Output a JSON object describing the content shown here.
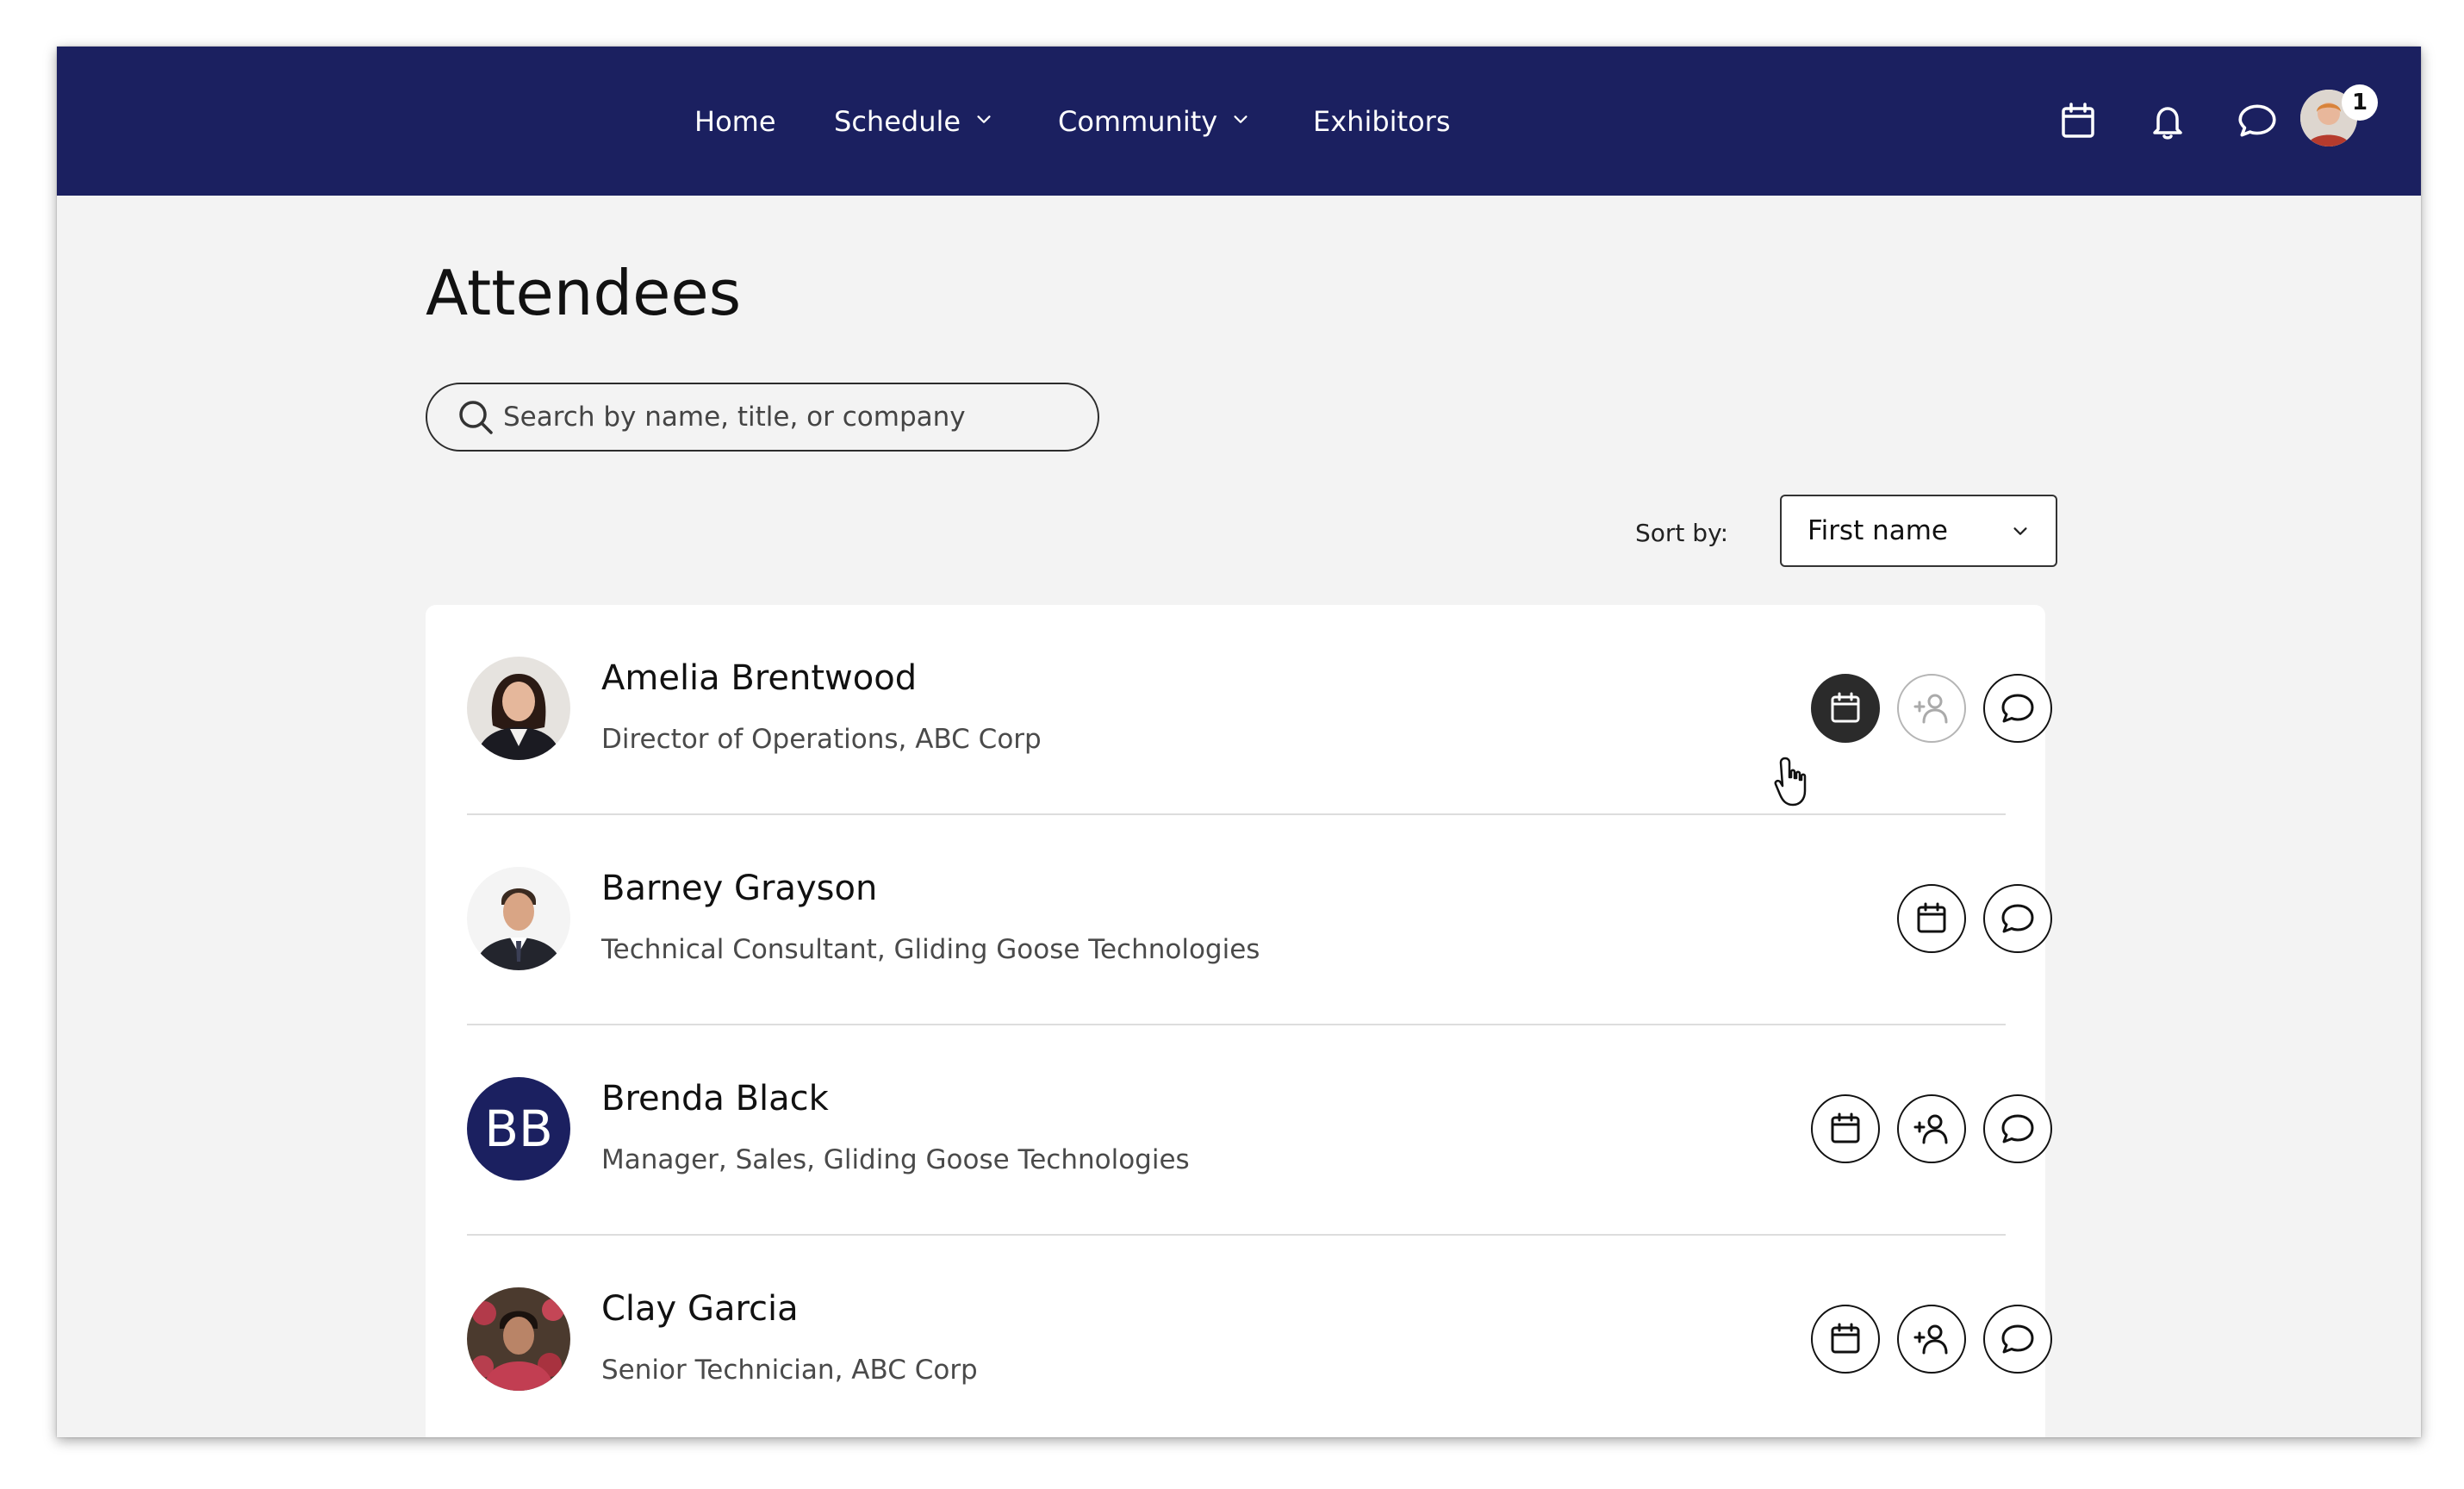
{
  "nav": {
    "items": [
      {
        "label": "Home"
      },
      {
        "label": "Schedule"
      },
      {
        "label": "Community"
      },
      {
        "label": "Exhibitors"
      }
    ],
    "notification_count": "1"
  },
  "page": {
    "title": "Attendees"
  },
  "search": {
    "placeholder": "Search by name, title, or company",
    "value": ""
  },
  "sort": {
    "label": "Sort by:",
    "selected": "First name"
  },
  "attendees": [
    {
      "name": "Amelia Brentwood",
      "title": "Director of Operations, ABC Corp",
      "avatar": "photo",
      "actions": [
        "calendar-icon",
        "add-contact-icon",
        "chat-icon"
      ]
    },
    {
      "name": "Barney Grayson",
      "title": "Technical Consultant, Gliding Goose Technologies",
      "avatar": "photo",
      "actions": [
        "calendar-icon",
        "chat-icon"
      ]
    },
    {
      "name": "Brenda Black",
      "title": "Manager, Sales, Gliding Goose Technologies",
      "avatar": "BB",
      "actions": [
        "calendar-icon",
        "add-contact-icon",
        "chat-icon"
      ]
    },
    {
      "name": "Clay Garcia",
      "title": "Senior Technician, ABC Corp",
      "avatar": "photo",
      "actions": [
        "calendar-icon",
        "add-contact-icon",
        "chat-icon"
      ]
    }
  ],
  "colors": {
    "navbar": "#1b2060",
    "background": "#f3f3f3",
    "card": "#ffffff",
    "initials_avatar": "#1b2060"
  }
}
